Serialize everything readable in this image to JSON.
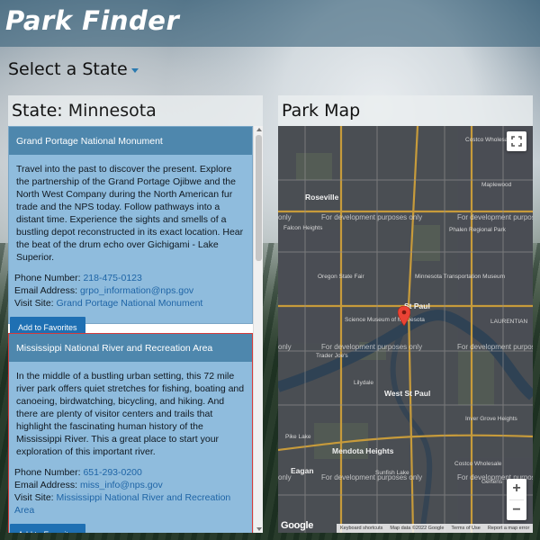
{
  "app": {
    "brand": "Park Finder"
  },
  "state_select": {
    "label": "Select a State"
  },
  "left_panel": {
    "title_prefix": "State:",
    "title_value": "Minnesota"
  },
  "map_panel": {
    "title": "Park Map"
  },
  "parks": [
    {
      "name": "Grand Portage National Monument",
      "description": "Travel into the past to discover the present. Explore the partnership of the Grand Portage Ojibwe and the North West Company during the North American fur trade and the NPS today. Follow pathways into a distant time. Experience the sights and smells of a bustling depot reconstructed in its exact location. Hear the beat of the drum echo over Gichigami - Lake Superior.",
      "phone_label": "Phone Number:",
      "phone": "218-475-0123",
      "email_label": "Email Address:",
      "email": "grpo_information@nps.gov",
      "visit_label": "Visit Site:",
      "visit_link": "Grand Portage National Monument",
      "button": "Add to Favorites"
    },
    {
      "name": "Mississippi National River and Recreation Area",
      "description": "In the middle of a bustling urban setting, this 72 mile river park offers quiet stretches for fishing, boating and canoeing, birdwatching, bicycling, and hiking. And there are plenty of visitor centers and trails that highlight the fascinating human history of the Mississippi River. This a great place to start your exploration of this important river.",
      "phone_label": "Phone Number:",
      "phone": "651-293-0200",
      "email_label": "Email Address:",
      "email": "miss_info@nps.gov",
      "visit_label": "Visit Site:",
      "visit_link": "Mississippi National River and Recreation Area",
      "button": "Add to Favorites"
    }
  ],
  "map": {
    "dev_text": "For development purposes only",
    "dev_text_short": "only",
    "places": {
      "costco": "Costco Wholesale",
      "roseville": "Roseville",
      "falcon": "Falcon Heights",
      "phalen": "Phalen Regional Park",
      "oregon": "Oregon State Fair",
      "mntransport": "Minnesota Transportation Museum",
      "stpaul": "St Paul",
      "science": "Science Museum of Minnesota",
      "traderjoes": "Trader Joe's",
      "lilydale": "Lilydale",
      "westpaul": "West St Paul",
      "inverheights": "Inver Grove Heights",
      "mendota": "Mendota Heights",
      "eagan": "Eagan",
      "pikelake": "Pike Lake",
      "sunfish": "Sunfish Lake",
      "costco2": "Costco Wholesale",
      "gertens": "Gertens",
      "maplewood": "Maplewood",
      "laurentian": "LAURENTIAN"
    },
    "zoom_in": "+",
    "zoom_out": "−",
    "logo": "Google",
    "attribution": {
      "shortcuts": "Keyboard shortcuts",
      "data": "Map data ©2022 Google",
      "terms": "Terms of Use",
      "report": "Report a map error"
    },
    "marker_color": "#ea4335"
  },
  "colors": {
    "header_bg": "#3c647d",
    "card_bg": "#8fbcdd",
    "card_head": "#4e87ad",
    "button": "#1f70b3",
    "link": "#1f65a6",
    "selected_border": "#d43b3b"
  }
}
